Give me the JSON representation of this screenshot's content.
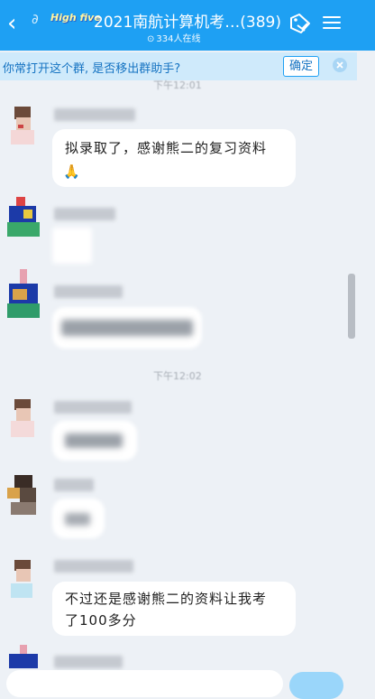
{
  "header": {
    "brand": "High five",
    "title": "2021南航计算机考…(389)",
    "online_count": "334人在线",
    "background": "#1ea0f3"
  },
  "notice": {
    "text": "你常打开这个群, 是否移出群助手?",
    "confirm_label": "确定"
  },
  "timestamps": [
    "下午12:01",
    "下午12:02"
  ],
  "messages": [
    {
      "text": "拟录取了，感谢熊二的复习资料"
    },
    {
      "text": "🙏"
    },
    {
      "text": "不过还是感谢熊二的资料让我考"
    },
    {
      "text": "了100多分"
    }
  ]
}
